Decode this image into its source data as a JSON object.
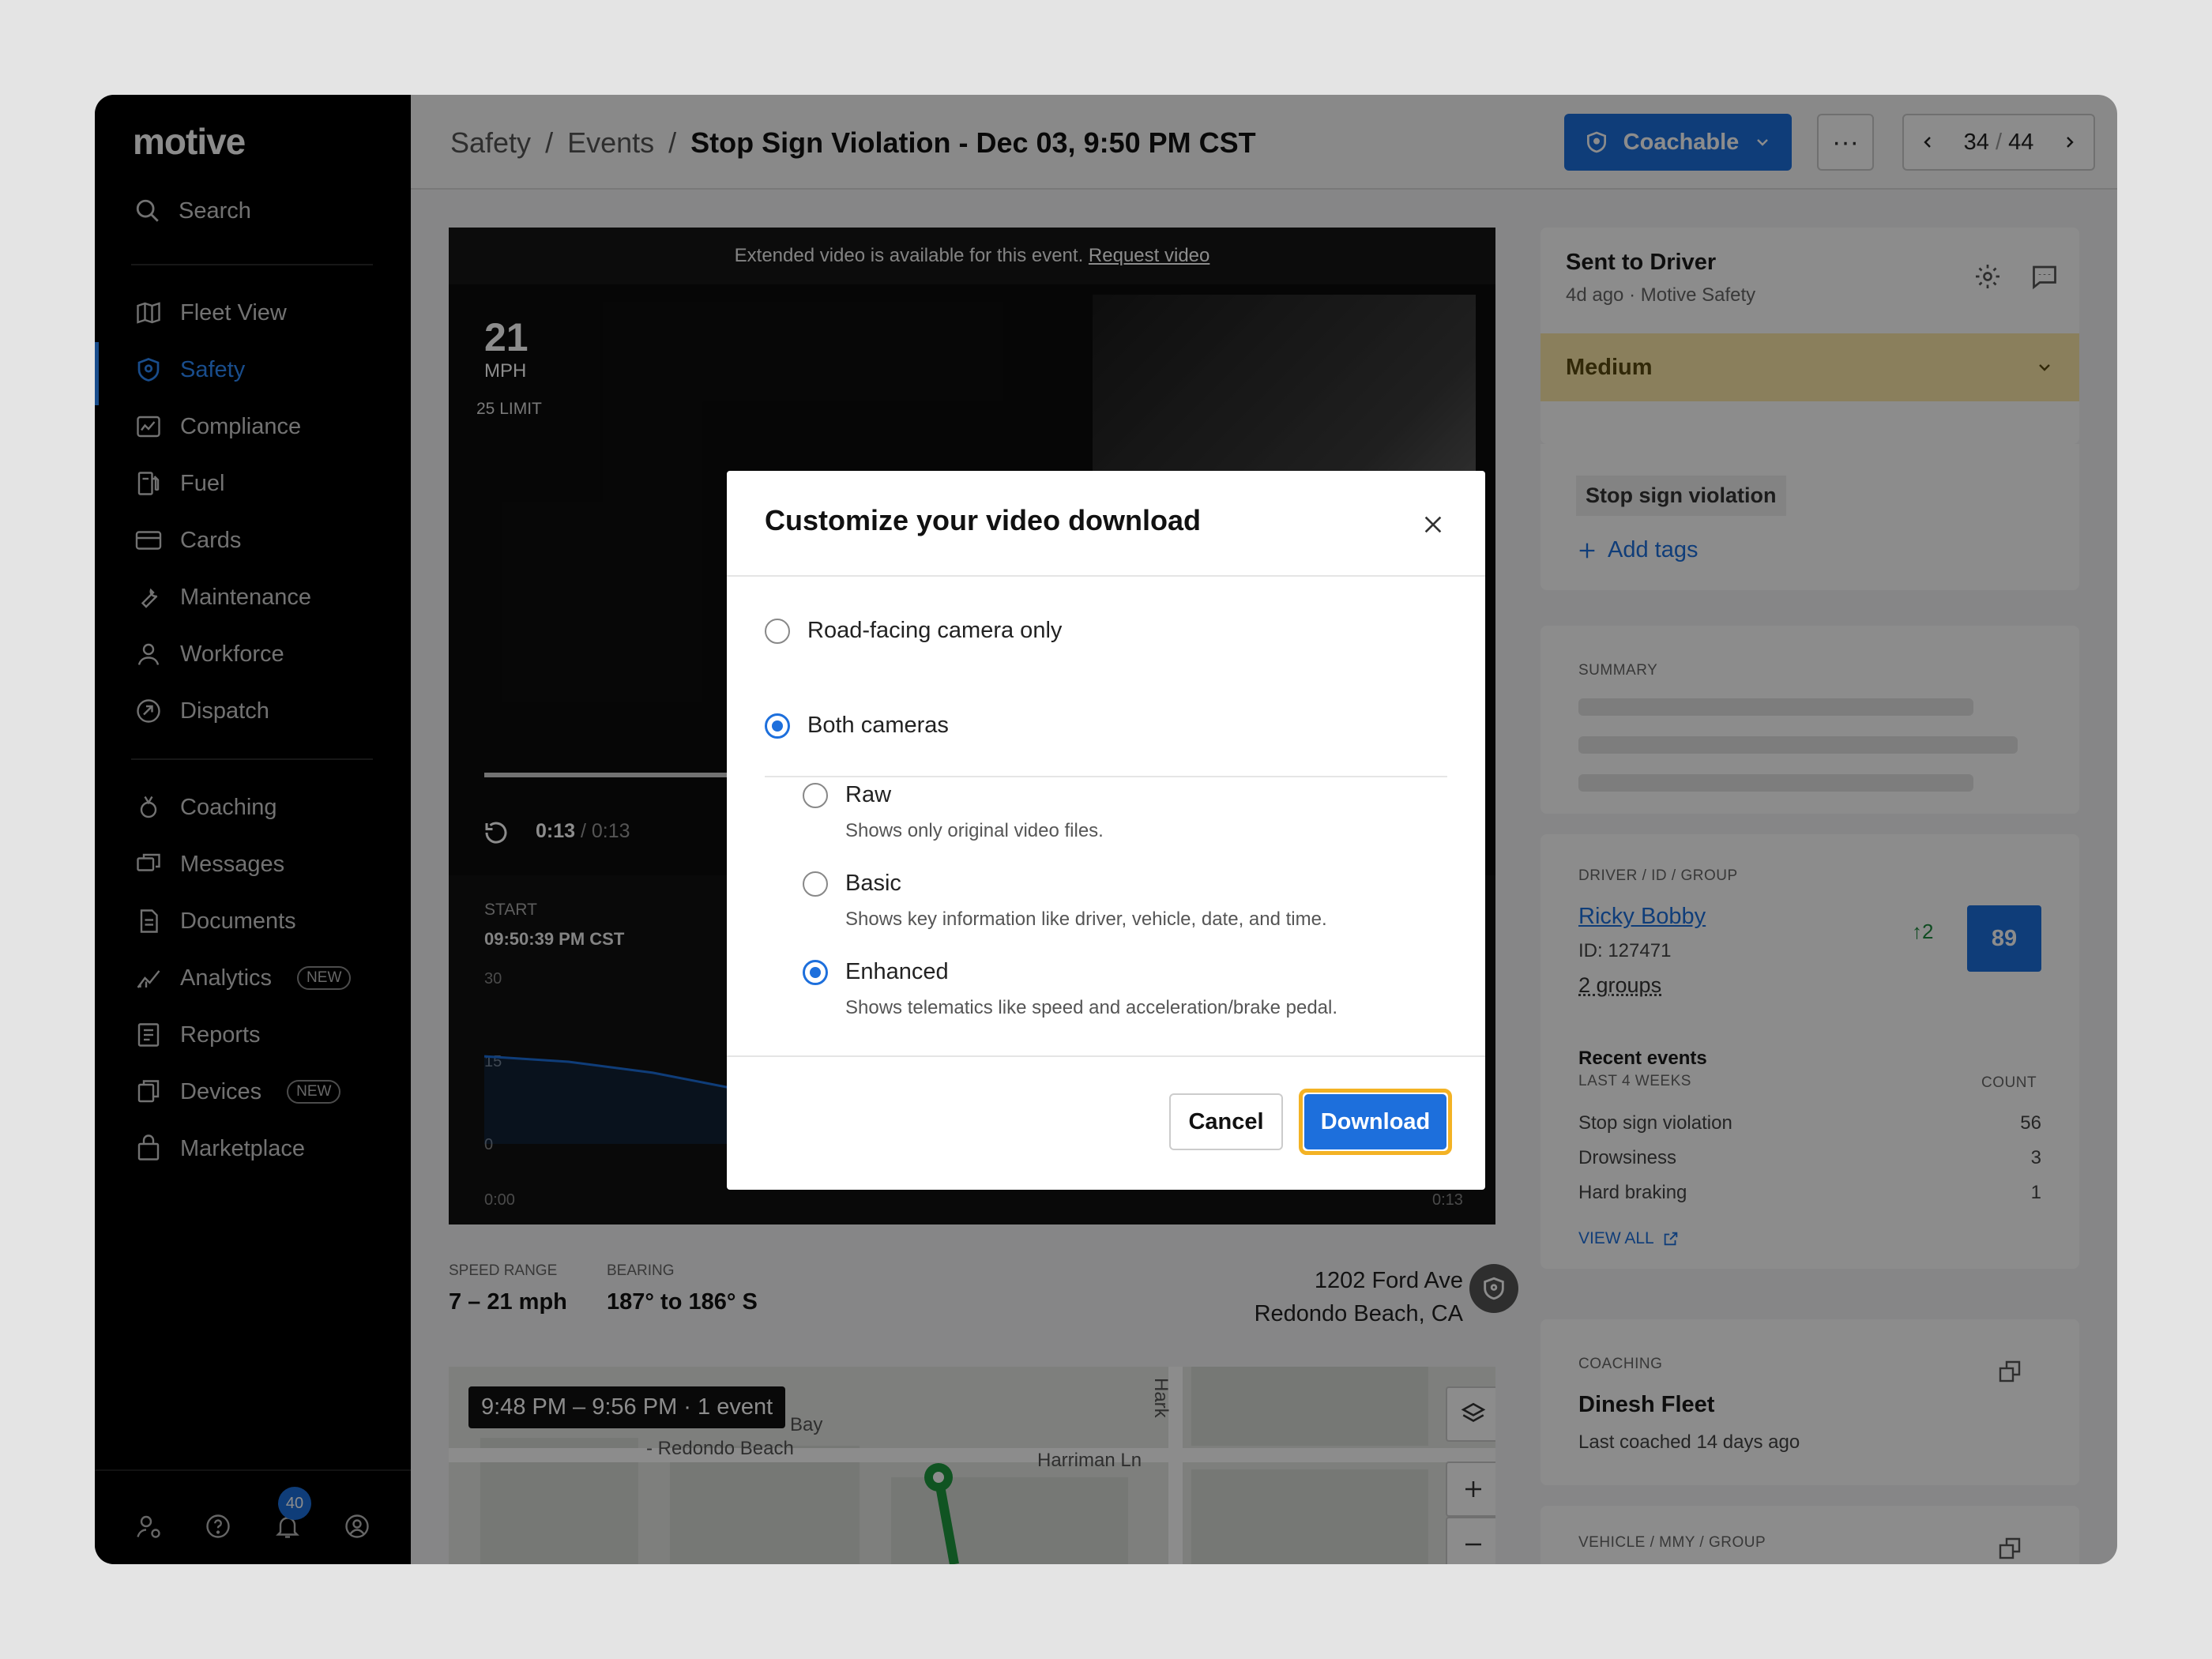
{
  "sidebar": {
    "logo": "motive",
    "search": "Search",
    "items": [
      {
        "label": "Fleet View",
        "icon": "map-icon"
      },
      {
        "label": "Safety",
        "icon": "shield-icon"
      },
      {
        "label": "Compliance",
        "icon": "compliance-icon"
      },
      {
        "label": "Fuel",
        "icon": "fuel-icon"
      },
      {
        "label": "Cards",
        "icon": "card-icon"
      },
      {
        "label": "Maintenance",
        "icon": "wrench-icon"
      },
      {
        "label": "Workforce",
        "icon": "person-icon"
      },
      {
        "label": "Dispatch",
        "icon": "dispatch-icon"
      },
      {
        "label": "Coaching",
        "icon": "coaching-icon"
      },
      {
        "label": "Messages",
        "icon": "messages-icon"
      },
      {
        "label": "Documents",
        "icon": "document-icon"
      },
      {
        "label": "Analytics",
        "icon": "analytics-icon",
        "badge": "NEW"
      },
      {
        "label": "Reports",
        "icon": "reports-icon"
      },
      {
        "label": "Devices",
        "icon": "devices-icon",
        "badge": "NEW"
      },
      {
        "label": "Marketplace",
        "icon": "bag-icon"
      }
    ],
    "notifications": "40"
  },
  "header": {
    "breadcrumb": [
      "Safety",
      "/",
      "Events",
      "/"
    ],
    "current": "Stop Sign Violation - Dec 03, 9:50 PM CST",
    "coachable": "Coachable",
    "more": "···",
    "pager_current": "34",
    "pager_sep": "/",
    "pager_total": "44"
  },
  "video": {
    "banner": "Extended video is available for this event.",
    "banner_link": "Request video",
    "speed": "21",
    "speed_unit": "MPH",
    "limit": "25 LIMIT",
    "time_current": "0:13",
    "time_total": "/ 0:13",
    "start_label": "START",
    "start_value": "09:50:39 PM CST",
    "progress": 1.0
  },
  "chart_data": {
    "type": "line",
    "x": [
      "0:00",
      "0:13"
    ],
    "yticks": [
      30,
      15,
      0
    ],
    "ylim": [
      0,
      30
    ],
    "series": [
      {
        "values": [
          16,
          15,
          13,
          10
        ]
      }
    ]
  },
  "meta": {
    "speed_range_label": "SPEED RANGE",
    "speed_range": "7 – 21 mph",
    "bearing_label": "BEARING",
    "bearing": "187° to 186° S",
    "address_line1": "1202 Ford Ave",
    "address_line2": "Redondo Beach, CA"
  },
  "map": {
    "chip": "9:48 PM – 9:56 PM · 1 event",
    "street1": "Harriman Ln",
    "street2": "- Redondo Beach",
    "street3": "Bay",
    "street4": "Hark"
  },
  "right": {
    "status": "Sent to Driver",
    "ago": "4d ago",
    "by": "Motive Safety",
    "severity": "Medium",
    "tag": "Stop sign violation",
    "add_tags": "Add tags",
    "summary_label": "SUMMARY",
    "driver_label": "DRIVER / ID / GROUP",
    "driver_name": "Ricky Bobby",
    "driver_id": "ID: 127471",
    "groups": "2 groups",
    "score_delta": "↑2",
    "score": "89",
    "recent_title": "Recent events",
    "recent_sub": "LAST 4 WEEKS",
    "count_label": "COUNT",
    "events": [
      {
        "name": "Stop sign violation",
        "count": "56"
      },
      {
        "name": "Drowsiness",
        "count": "3"
      },
      {
        "name": "Hard braking",
        "count": "1"
      }
    ],
    "view_all": "VIEW ALL",
    "coaching_label": "COACHING",
    "coach_name": "Dinesh Fleet",
    "coach_last": "Last coached 14 days ago",
    "vehicle_label": "VEHICLE / MMY / GROUP"
  },
  "modal": {
    "title": "Customize your video download",
    "opt_road": "Road-facing camera only",
    "opt_both": "Both cameras",
    "raw": "Raw",
    "raw_desc": "Shows only original video files.",
    "basic": "Basic",
    "basic_desc": "Shows key information like driver, vehicle, date, and time.",
    "enhanced": "Enhanced",
    "enhanced_desc": "Shows telematics like speed and acceleration/brake pedal.",
    "cancel": "Cancel",
    "download": "Download"
  }
}
